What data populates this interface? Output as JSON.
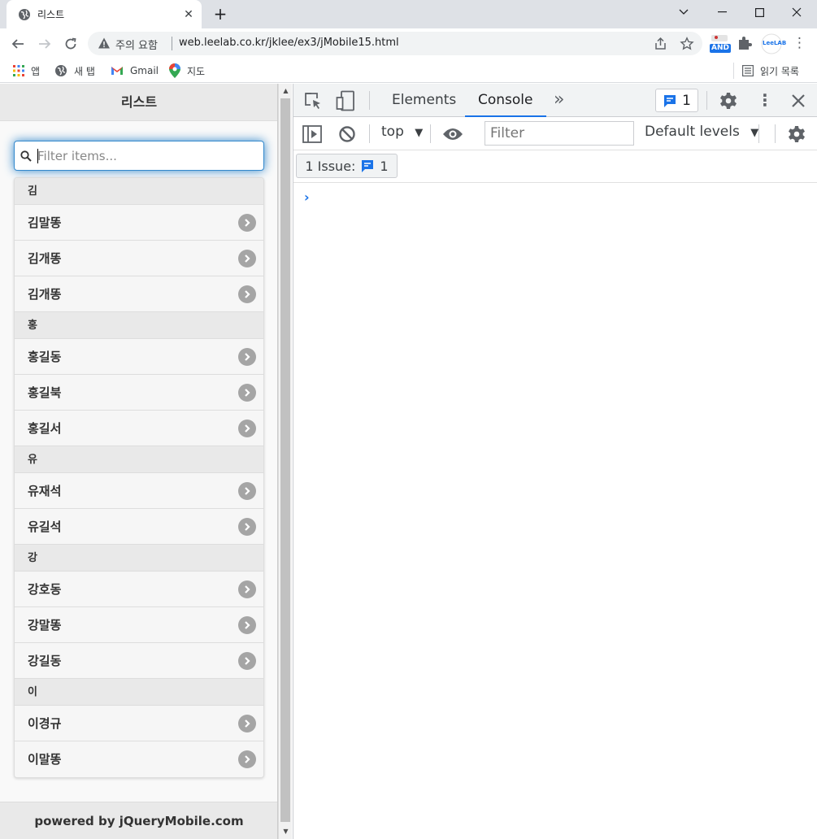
{
  "browser": {
    "tab_title": "리스트",
    "tab_close": "✕",
    "new_tab": "+",
    "window_buttons": {
      "minimize": "—",
      "maximize": "☐",
      "close": "✕",
      "dropdown": "⌄"
    },
    "security_warning": "주의 요함",
    "url": "web.leelab.co.kr/jklee/ex3/jMobile15.html",
    "extension_badge": "AND",
    "extension_leelab": "LeeLAB",
    "menu": "⋮",
    "bookmarks": [
      {
        "label": "앱",
        "icon": "apps-grid-icon"
      },
      {
        "label": "새 탭",
        "icon": "globe-icon"
      },
      {
        "label": "Gmail",
        "icon": "gmail-icon"
      },
      {
        "label": "지도",
        "icon": "maps-pin-icon"
      }
    ],
    "reading_list": "읽기 목록"
  },
  "page": {
    "header_title": "리스트",
    "filter": {
      "placeholder": "Filter items...",
      "value": ""
    },
    "groups": [
      {
        "divider": "김",
        "items": [
          "김말똥",
          "김개똥",
          "김개똥"
        ]
      },
      {
        "divider": "홍",
        "items": [
          "홍길동",
          "홍길북",
          "홍길서"
        ]
      },
      {
        "divider": "유",
        "items": [
          "유재석",
          "유길석"
        ]
      },
      {
        "divider": "강",
        "items": [
          "강호동",
          "강말똥",
          "강길동"
        ]
      },
      {
        "divider": "이",
        "items": [
          "이경규",
          "이말똥"
        ]
      }
    ],
    "footer": "powered by jQueryMobile.com"
  },
  "devtools": {
    "tabs": [
      "Elements",
      "Console"
    ],
    "active_tab": "Console",
    "more_tabs": "»",
    "issue_count": "1",
    "menu": "⋮",
    "close": "✕",
    "context": "top",
    "context_arrow": "▼",
    "filter_placeholder": "Filter",
    "levels": "Default levels",
    "levels_arrow": "▼",
    "issues_label": "1 Issue:",
    "issues_count": "1",
    "prompt": "›"
  },
  "colors": {
    "accent": "#1a73e8",
    "focus_glow": "#3388cc",
    "list_arrow": "#a5a5a5"
  }
}
